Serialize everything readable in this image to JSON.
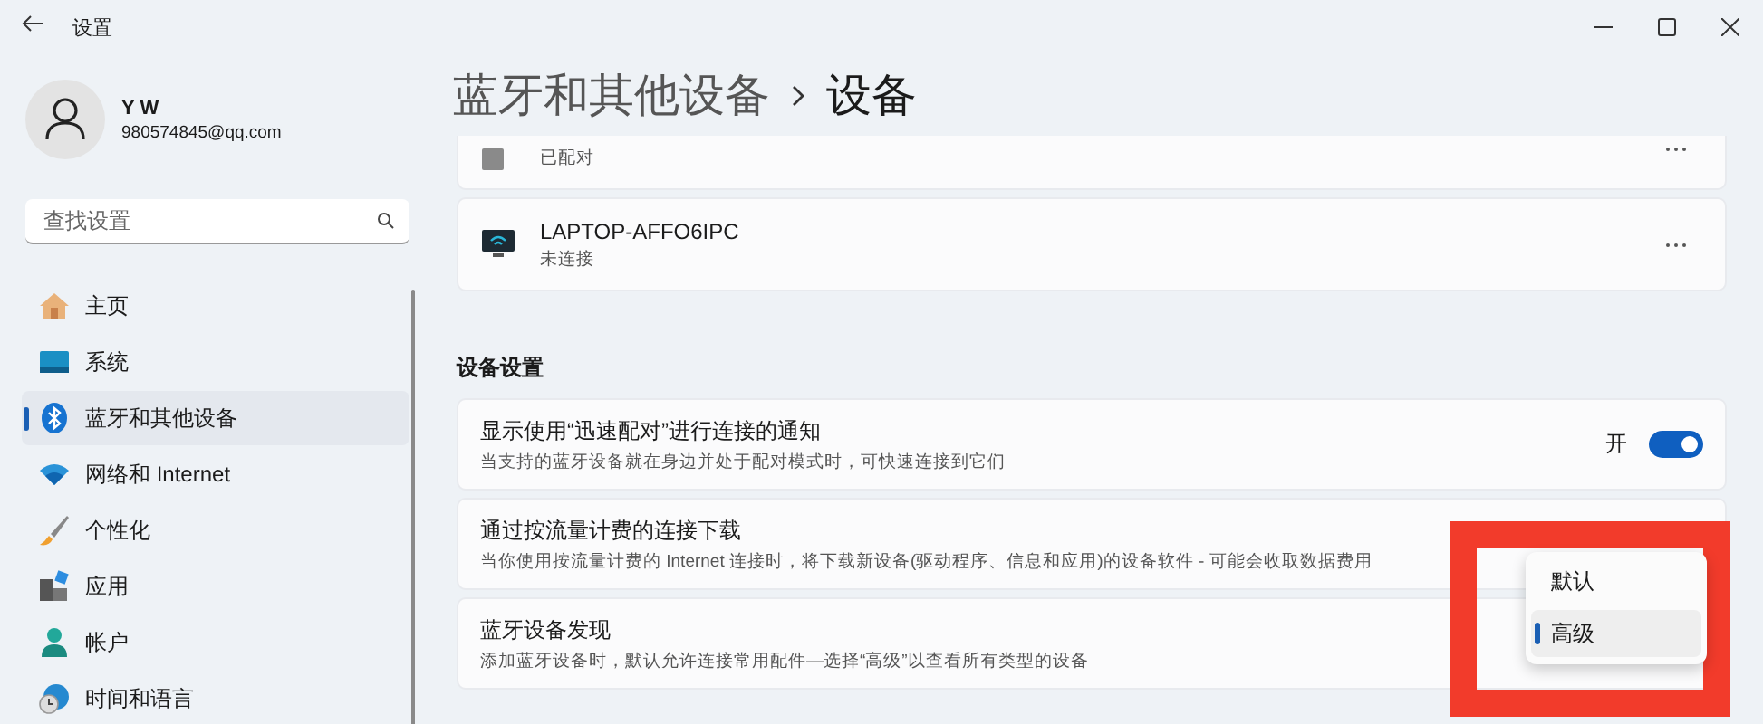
{
  "window": {
    "title": "设置"
  },
  "user": {
    "name": "Y W",
    "email": "980574845@qq.com"
  },
  "search": {
    "placeholder": "查找设置"
  },
  "nav": [
    {
      "label": "主页",
      "kind": "home",
      "selected": false
    },
    {
      "label": "系统",
      "kind": "system",
      "selected": false
    },
    {
      "label": "蓝牙和其他设备",
      "kind": "bluetooth",
      "selected": true
    },
    {
      "label": "网络和 Internet",
      "kind": "network",
      "selected": false
    },
    {
      "label": "个性化",
      "kind": "brush",
      "selected": false
    },
    {
      "label": "应用",
      "kind": "apps",
      "selected": false
    },
    {
      "label": "帐户",
      "kind": "account",
      "selected": false
    },
    {
      "label": "时间和语言",
      "kind": "time",
      "selected": false
    }
  ],
  "breadcrumb": [
    "蓝牙和其他设备",
    "设备"
  ],
  "devices": [
    {
      "status": "已配对",
      "kind": "generic"
    },
    {
      "name": "LAPTOP-AFFO6IPC",
      "status": "未连接",
      "kind": "monitor"
    }
  ],
  "section": "设备设置",
  "settings": [
    {
      "title": "显示使用“迅速配对”进行连接的通知",
      "description": "当支持的蓝牙设备就在身边并处于配对模式时，可快速连接到它们",
      "kind": "toggle",
      "on": true,
      "state_label": "开"
    },
    {
      "title": "通过按流量计费的连接下载",
      "description": "当你使用按流量计费的 Internet 连接时，将下载新设备(驱动程序、信息和应用)的设备软件 - 可能会收取数据费用",
      "kind": "plain"
    },
    {
      "title": "蓝牙设备发现",
      "description": "添加蓝牙设备时，默认允许连接常用配件—选择“高级”以查看所有类型的设备",
      "kind": "dropdown"
    }
  ],
  "menu": [
    {
      "label": "默认",
      "selected": false
    },
    {
      "label": "高级",
      "selected": true
    }
  ]
}
